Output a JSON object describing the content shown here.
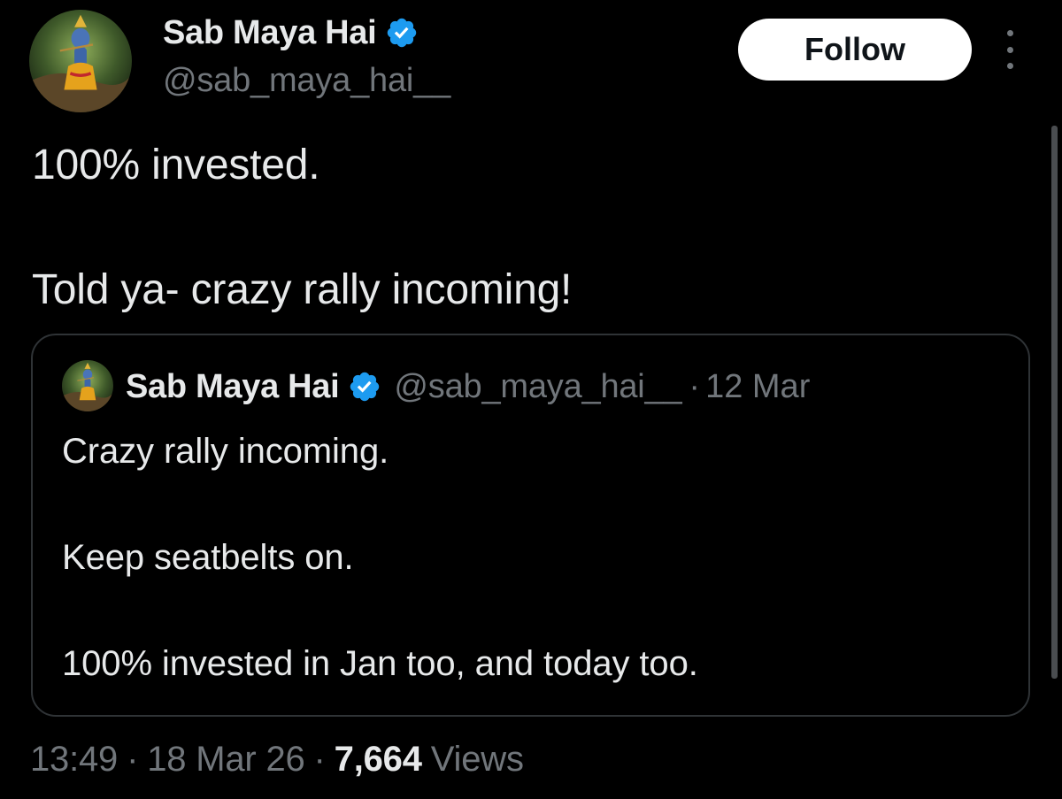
{
  "author": {
    "display_name": "Sab Maya Hai",
    "handle": "@sab_maya_hai__",
    "verified": true
  },
  "follow_button": {
    "label": "Follow"
  },
  "tweet": {
    "lines": [
      "100% invested.",
      "Told ya- crazy rally incoming!"
    ]
  },
  "quoted_tweet": {
    "display_name": "Sab Maya Hai",
    "handle": "@sab_maya_hai__",
    "separator": "·",
    "date": "12 Mar",
    "lines": [
      "Crazy rally incoming.",
      "Keep seatbelts on.",
      "100% invested in Jan too, and today too."
    ]
  },
  "meta": {
    "time": "13:49",
    "separator": "·",
    "date": "18 Mar 26",
    "views_count": "7,664",
    "views_label": "Views"
  },
  "colors": {
    "background": "#000000",
    "text_primary": "#e7e9ea",
    "text_secondary": "#71767b",
    "verified_blue": "#1d9bf0",
    "border": "#2f3336"
  }
}
